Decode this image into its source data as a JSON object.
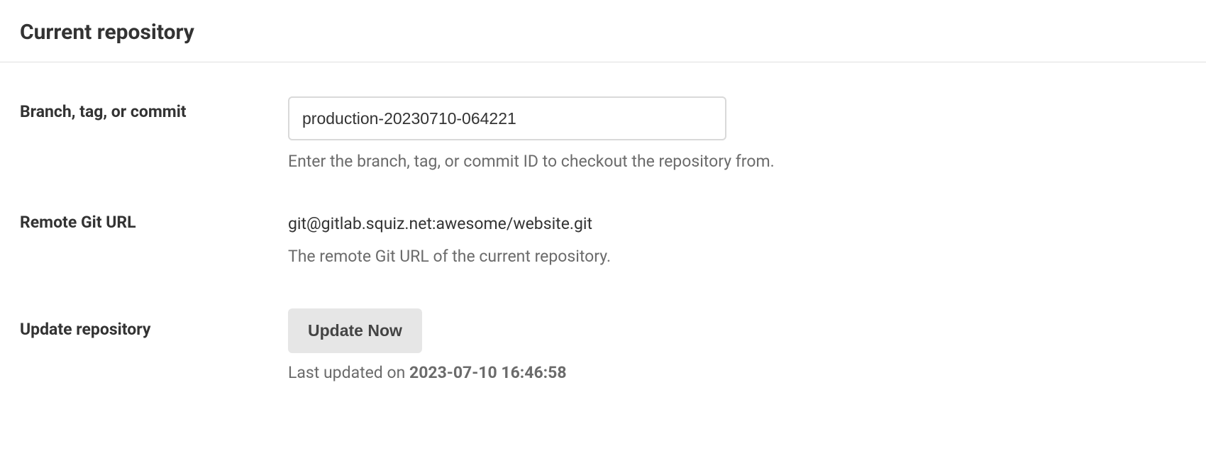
{
  "section": {
    "title": "Current repository"
  },
  "fields": {
    "branch": {
      "label": "Branch, tag, or commit",
      "value": "production-20230710-064221",
      "help": "Enter the branch, tag, or commit ID to checkout the repository from."
    },
    "remote": {
      "label": "Remote Git URL",
      "value": "git@gitlab.squiz.net:awesome/website.git",
      "help": "The remote Git URL of the current repository."
    },
    "update": {
      "label": "Update repository",
      "button": "Update Now",
      "last_updated_prefix": "Last updated on ",
      "last_updated_timestamp": "2023-07-10 16:46:58"
    }
  }
}
